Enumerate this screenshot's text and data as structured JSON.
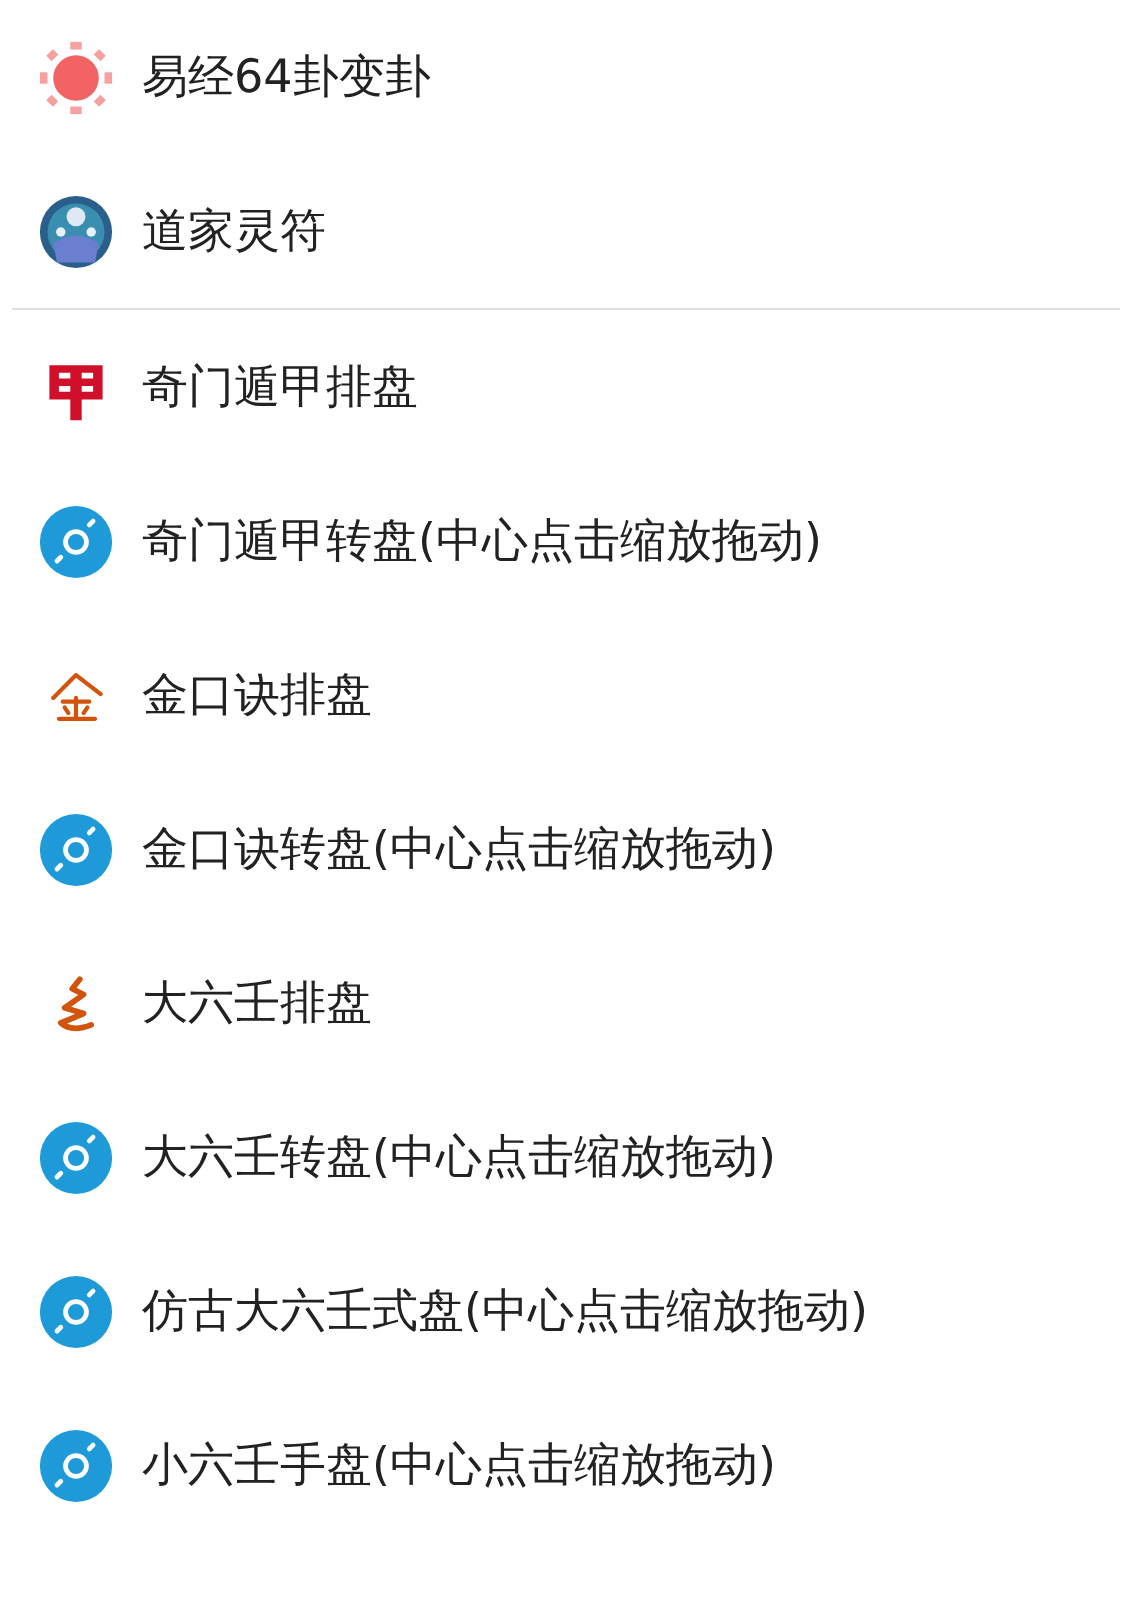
{
  "sections": [
    {
      "items": [
        {
          "kind": "sun",
          "label": "易经64卦变卦"
        },
        {
          "kind": "talisman",
          "label": "道家灵符"
        }
      ]
    },
    {
      "items": [
        {
          "kind": "stamp",
          "label": "奇门遁甲排盘"
        },
        {
          "kind": "disc",
          "label": "奇门遁甲转盘(中心点击缩放拖动)"
        },
        {
          "kind": "seal",
          "label": "金口诀排盘"
        },
        {
          "kind": "disc",
          "label": "金口诀转盘(中心点击缩放拖动)"
        },
        {
          "kind": "squiggle",
          "label": "大六壬排盘"
        },
        {
          "kind": "disc",
          "label": "大六壬转盘(中心点击缩放拖动)"
        },
        {
          "kind": "disc",
          "label": "仿古大六壬式盘(中心点击缩放拖动)"
        },
        {
          "kind": "disc",
          "label": "小六壬手盘(中心点击缩放拖动)"
        }
      ]
    }
  ]
}
